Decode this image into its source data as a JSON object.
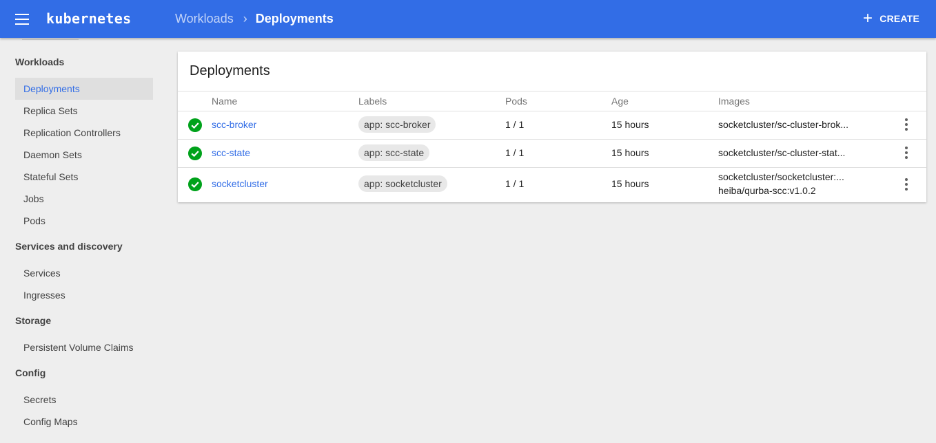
{
  "header": {
    "brand": "kubernetes",
    "breadcrumb_parent": "Workloads",
    "breadcrumb_separator": "›",
    "breadcrumb_current": "Deployments",
    "create_icon": "+",
    "create_label": "CREATE",
    "bar_color": "#326de6"
  },
  "sidebar": {
    "workloads_title": "Workloads",
    "workloads_items": [
      "Deployments",
      "Replica Sets",
      "Replication Controllers",
      "Daemon Sets",
      "Stateful Sets",
      "Jobs",
      "Pods"
    ],
    "discovery_title": "Services and discovery",
    "discovery_items": [
      "Services",
      "Ingresses"
    ],
    "storage_title": "Storage",
    "storage_items": [
      "Persistent Volume Claims"
    ],
    "config_title": "Config",
    "config_items": [
      "Secrets",
      "Config Maps"
    ],
    "active_item": "Deployments"
  },
  "card": {
    "title": "Deployments",
    "columns": [
      "Name",
      "Labels",
      "Pods",
      "Age",
      "Images"
    ],
    "rows": [
      {
        "status": "ok",
        "name": "scc-broker",
        "label": "app: scc-broker",
        "pods": "1 / 1",
        "age": "15 hours",
        "image1": "socketcluster/sc-cluster-brok...",
        "image2": ""
      },
      {
        "status": "ok",
        "name": "scc-state",
        "label": "app: scc-state",
        "pods": "1 / 1",
        "age": "15 hours",
        "image1": "socketcluster/sc-cluster-stat...",
        "image2": ""
      },
      {
        "status": "ok",
        "name": "socketcluster",
        "label": "app: socketcluster",
        "pods": "1 / 1",
        "age": "15 hours",
        "image1": "socketcluster/socketcluster:...",
        "image2": "heiba/qurba-scc:v1.0.2"
      }
    ]
  }
}
